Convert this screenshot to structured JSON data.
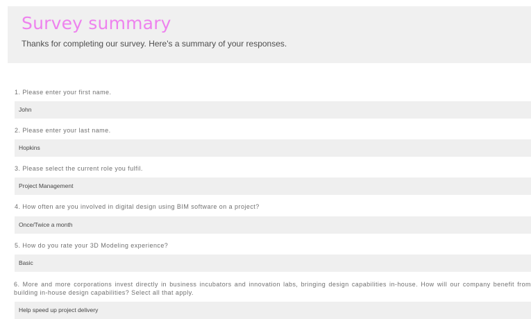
{
  "header": {
    "title": "Survey summary",
    "subtitle": "Thanks for completing our survey. Here's a summary of your responses.",
    "title_color": "#ee82ee",
    "background_color": "#f0f0f0"
  },
  "questions": [
    {
      "label": "1. Please enter your first name.",
      "answer": "John"
    },
    {
      "label": "2. Please enter your last name.",
      "answer": "Hopkins"
    },
    {
      "label": "3. Please select the current role you fulfil.",
      "answer": "Project Management"
    },
    {
      "label": "4. How often are you involved in digital design using BIM software on a project?",
      "answer": "Once/Twice a month"
    },
    {
      "label": "5. How do you rate your 3D Modeling experience?",
      "answer": "Basic"
    },
    {
      "label": "6. More and more corporations invest directly in business incubators and innovation labs, bringing design capabilities in-house. How will our company benefit from building in-house design capabilities? Select all that apply.",
      "answer": "Help speed up project delivery"
    }
  ]
}
